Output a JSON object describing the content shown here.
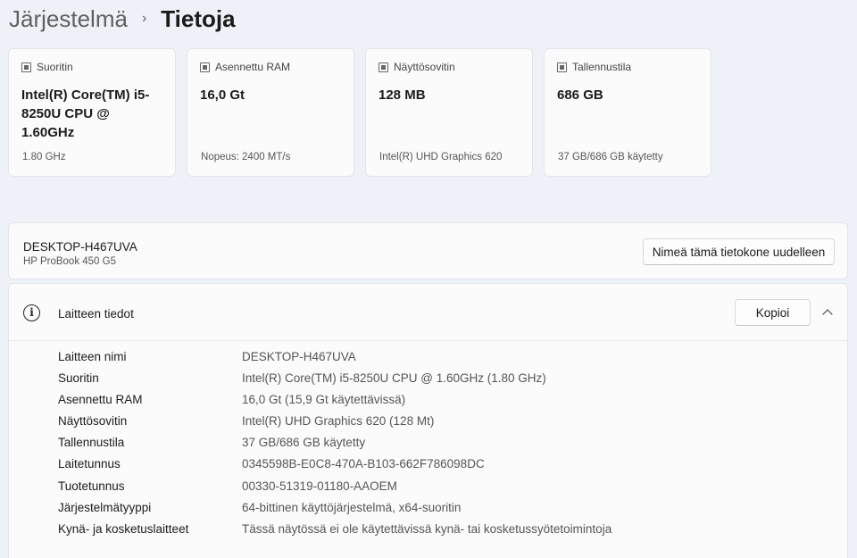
{
  "breadcrumb": {
    "parent": "Järjestelmä",
    "current": "Tietoja"
  },
  "cards": [
    {
      "icon": "cpu-icon",
      "label": "Suoritin",
      "value": "Intel(R) Core(TM) i5-8250U CPU @ 1.60GHz",
      "sub": "1.80 GHz"
    },
    {
      "icon": "ram-icon",
      "label": "Asennettu RAM",
      "value": "16,0 Gt",
      "sub": "Nopeus: 2400 MT/s"
    },
    {
      "icon": "display-adapter-icon",
      "label": "Näyttösovitin",
      "value": "128 MB",
      "sub": "Intel(R) UHD Graphics 620"
    },
    {
      "icon": "storage-icon",
      "label": "Tallennustila",
      "value": "686 GB",
      "sub": "37 GB/686 GB käytetty"
    }
  ],
  "device": {
    "name": "DESKTOP-H467UVA",
    "model": "HP ProBook 450 G5",
    "rename_label": "Nimeä tämä tietokone uudelleen"
  },
  "details": {
    "title": "Laitteen tiedot",
    "copy_label": "Kopioi",
    "rows": [
      {
        "label": "Laitteen nimi",
        "value": "DESKTOP-H467UVA"
      },
      {
        "label": "Suoritin",
        "value": "Intel(R) Core(TM) i5-8250U CPU @ 1.60GHz (1.80 GHz)"
      },
      {
        "label": "Asennettu RAM",
        "value": "16,0 Gt (15,9 Gt käytettävissä)"
      },
      {
        "label": "Näyttösovitin",
        "value": "Intel(R) UHD Graphics 620 (128 Mt)"
      },
      {
        "label": "Tallennustila",
        "value": "37 GB/686 GB käytetty"
      },
      {
        "label": "Laitetunnus",
        "value": "0345598B-E0C8-470A-B103-662F786098DC"
      },
      {
        "label": "Tuotetunnus",
        "value": "00330-51319-01180-AAOEM"
      },
      {
        "label": "Järjestelmätyyppi",
        "value": "64-bittinen käyttöjärjestelmä, x64-suoritin"
      },
      {
        "label": "Kynä- ja kosketuslaitteet",
        "value": "Tässä näytössä ei ole käytettävissä kynä- tai kosketussyötetoimintoja"
      }
    ]
  }
}
